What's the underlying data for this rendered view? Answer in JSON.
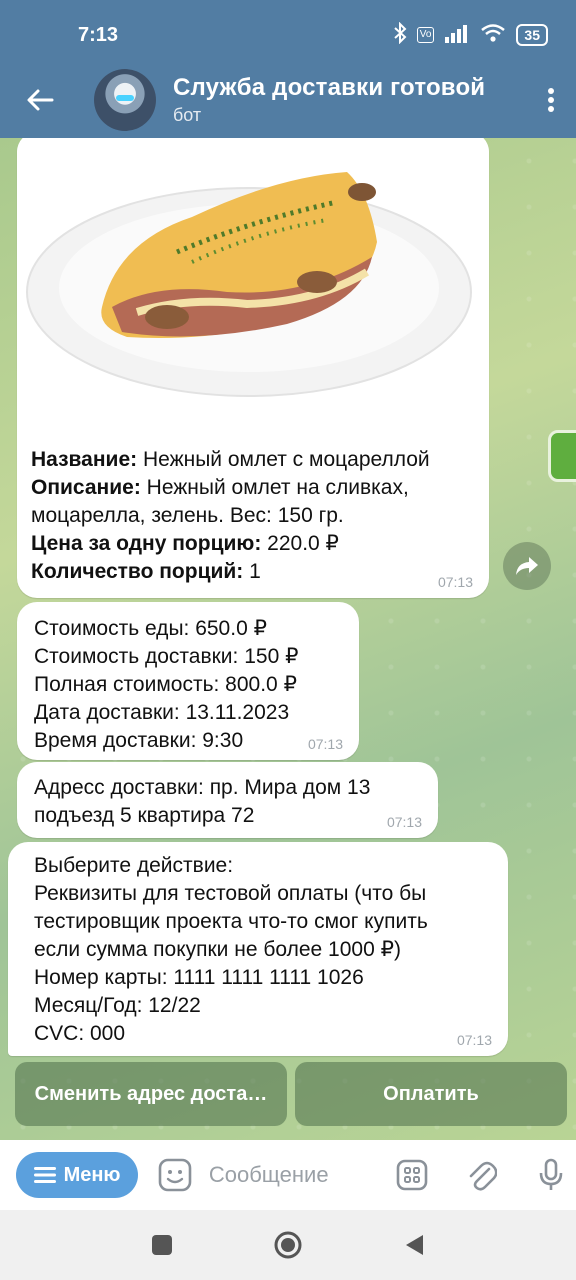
{
  "status": {
    "time": "7:13",
    "battery": "35"
  },
  "header": {
    "title": "Служба доставки готовой",
    "subtitle": "бот"
  },
  "messages": {
    "product": {
      "name_label": "Название:",
      "name_value": " Нежный омлет с моцареллой",
      "desc_label": "Описание:",
      "desc_value": " Нежный омлет на сливках, моцарелла, зелень. Вес: 150 гр.",
      "price_label": "Цена за одну порцию:",
      "price_value": " 220.0 ₽",
      "qty_label": "Количество порций:",
      "qty_value": " 1",
      "time": "07:13"
    },
    "cost": {
      "lines": [
        "Стоимость еды: 650.0 ₽",
        "Стоимость доставки: 150 ₽",
        "Полная стоимость: 800.0 ₽",
        "Дата доставки: 13.11.2023",
        "Время доставки: 9:30"
      ],
      "time": "07:13"
    },
    "address": {
      "lines": [
        "Адресс доставки: пр. Мира дом 13",
        "подъезд 5 квартира 72"
      ],
      "time": "07:13"
    },
    "action": {
      "lines": [
        "Выберите действие:",
        "Реквизиты для тестовой оплаты (что бы",
        "тестировщик проекта что-то смог купить",
        "если сумма покупки не более 1000 ₽)",
        "Номер карты: 1111 1111 1111 1026",
        "Месяц/Год: 12/22",
        "CVC: 000"
      ],
      "time": "07:13"
    }
  },
  "keyboard": {
    "change_address": "Сменить адрес доста…",
    "pay": "Оплатить"
  },
  "input": {
    "menu_label": "Меню",
    "placeholder": "Сообщение"
  },
  "colors": {
    "header": "#527da3",
    "menu_button": "#5ba0dd",
    "keyboard_button": "#4c6e4a"
  }
}
